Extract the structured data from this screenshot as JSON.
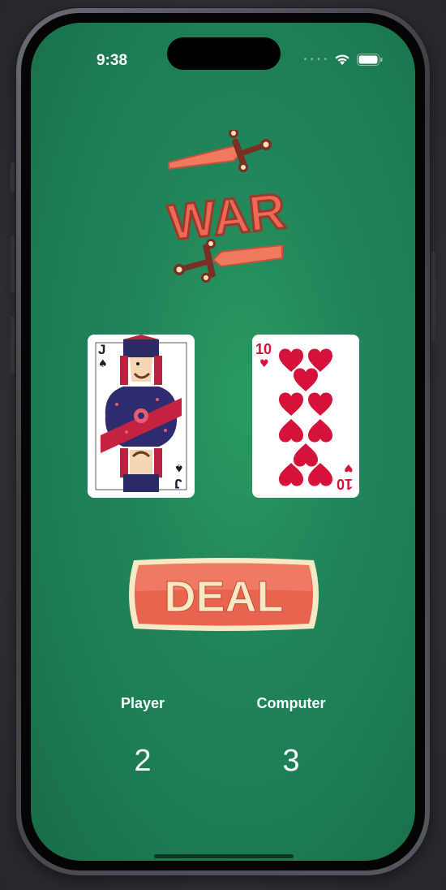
{
  "status_bar": {
    "time": "9:38"
  },
  "logo": {
    "text": "WAR"
  },
  "cards": {
    "player": {
      "rank": "J",
      "suit": "spades"
    },
    "computer": {
      "rank": "10",
      "suit": "hearts"
    }
  },
  "deal_button": {
    "label": "DEAL"
  },
  "scores": {
    "player_label": "Player",
    "player_value": "2",
    "computer_label": "Computer",
    "computer_value": "3"
  },
  "colors": {
    "felt": "#21865a",
    "button": "#e8644f",
    "button_border": "#f8e9c6",
    "logo": "#ec6a55"
  }
}
